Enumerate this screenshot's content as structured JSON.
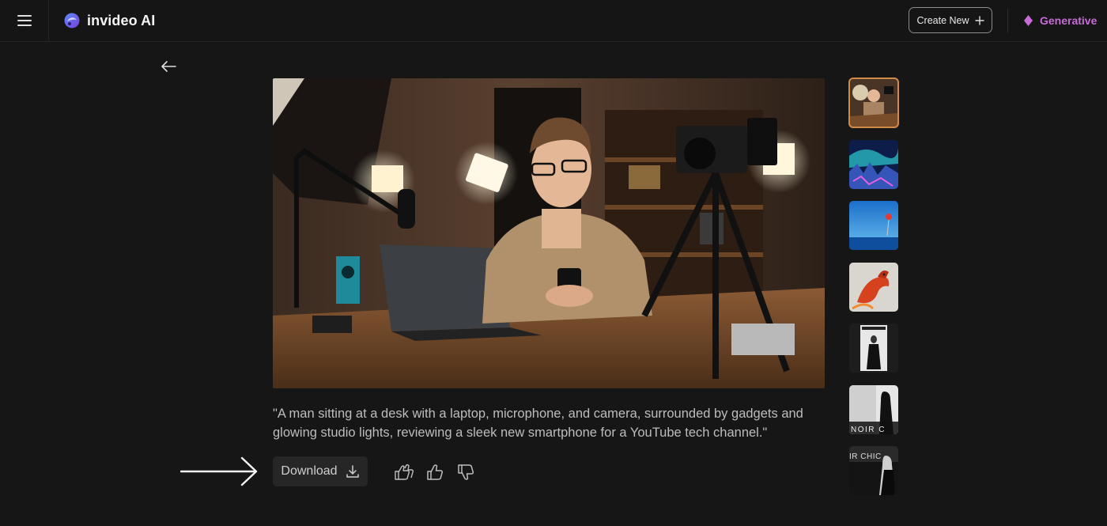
{
  "header": {
    "brand": "invideo AI",
    "create_new_label": "Create New",
    "generative_label": "Generative"
  },
  "main": {
    "caption": "\"A man sitting at a desk with a laptop, microphone, and camera, surrounded by gadgets and glowing studio lights, reviewing a sleek new smartphone for a YouTube tech channel.\"",
    "download_label": "Download"
  },
  "thumbnails": {
    "t1": {
      "label": ""
    },
    "t5": {
      "label": ""
    },
    "t6": {
      "label": "NOIR C"
    },
    "t7": {
      "label": "IR CHIC"
    }
  },
  "colors": {
    "accent_generative": "#c86ad8",
    "active_thumb_border": "#d08a47",
    "background": "#161616"
  },
  "icons": {
    "menu": "hamburger-icon",
    "back": "arrow-left-icon",
    "create": "plus-icon",
    "generative": "diamond-icon",
    "download": "download-icon",
    "love": "double-thumbs-up-icon",
    "like": "thumbs-up-icon",
    "dislike": "thumbs-down-icon"
  }
}
